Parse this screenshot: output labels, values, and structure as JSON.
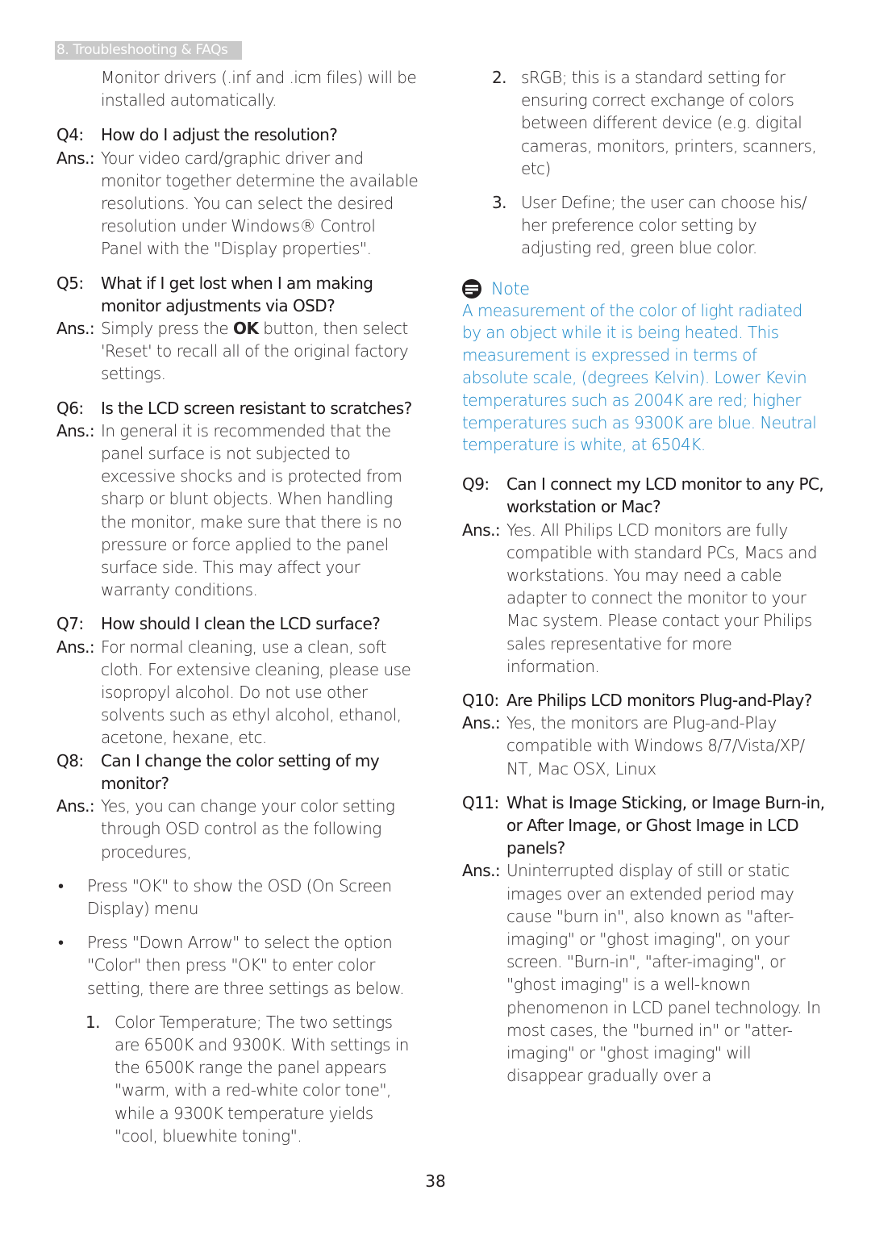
{
  "header": {
    "section_tag": "8. Troubleshooting & FAQs"
  },
  "left": {
    "intro_continuation": "Monitor drivers (.inf and .icm files) will be installed automatically.",
    "q4": {
      "label": "Q4:",
      "question": "How do I adjust the resolution?",
      "ans_label": "Ans.:",
      "answer": "Your video card/graphic driver and monitor together determine the available resolutions. You can select the desired resolution under Windows® Control Panel with the \"Display properties\"."
    },
    "q5": {
      "label": "Q5:",
      "question": "What if I get lost when I am making monitor adjustments via OSD?",
      "ans_label": "Ans.:",
      "answer_pre": "Simply press the ",
      "answer_bold": "OK",
      "answer_post": " button, then select 'Reset' to recall all of the original factory settings."
    },
    "q6": {
      "label": "Q6:",
      "question": "Is the LCD screen resistant to scratches?",
      "ans_label": "Ans.:",
      "answer": "In general it is recommended that the panel surface is not subjected to excessive shocks and is protected from sharp or blunt objects. When handling the monitor, make sure that there is no pressure or force applied to the panel surface side. This may affect your warranty conditions."
    },
    "q7": {
      "label": "Q7:",
      "question": "How should I clean the LCD surface?",
      "ans_label": "Ans.:",
      "answer": "For normal cleaning, use a clean, soft cloth. For extensive cleaning, please use isopropyl alcohol. Do not use other solvents such as ethyl alcohol, ethanol, acetone, hexane, etc."
    },
    "q8": {
      "label": "Q8:",
      "question": "Can I change the color setting of my monitor?",
      "ans_label": "Ans.:",
      "answer": "Yes, you can change your color setting through OSD control as the following procedures,"
    },
    "bullets": [
      {
        "marker": "•",
        "text": "Press \"OK\" to show the OSD (On Screen Display) menu"
      },
      {
        "marker": "•",
        "text": "Press \"Down Arrow\" to select the option \"Color\" then press \"OK\" to enter color setting, there are three settings as below."
      }
    ],
    "settings_first": {
      "number": "1.",
      "text": "Color Temperature; The two settings are 6500K and 9300K. With settings in the 6500K range the panel appears \"warm, with a red-white color tone\", while a 9300K temperature yields \"cool, bluewhite toning\"."
    }
  },
  "right": {
    "settings_rest": [
      {
        "number": "2.",
        "text": "sRGB; this is a standard setting for ensuring correct exchange of colors between different device (e.g. digital cameras, monitors, printers, scanners, etc)"
      },
      {
        "number": "3.",
        "text": "User Define; the user can choose his/ her preference color setting by adjusting red, green blue color."
      }
    ],
    "note": {
      "icon": "note-icon",
      "title": "Note",
      "body": "A measurement of the color of light radiated by an object while it is being heated. This measurement is expressed in terms of absolute scale, (degrees Kelvin). Lower Kevin temperatures such as 2004K are red; higher temperatures such as 9300K are blue. Neutral temperature is white, at 6504K.",
      "color": "#1a88c9"
    },
    "q9": {
      "label": "Q9:",
      "question": "Can I connect my LCD monitor to any PC, workstation or Mac?",
      "ans_label": "Ans.:",
      "answer": "Yes. All Philips LCD monitors are fully compatible with standard PCs, Macs and workstations. You may need a cable adapter to connect the monitor to your Mac system. Please contact your Philips sales representative for more information."
    },
    "q10": {
      "label": "Q10:",
      "question": "Are Philips LCD monitors Plug-and-Play?",
      "ans_label": "Ans.:",
      "answer": "Yes, the monitors are Plug-and-Play compatible with Windows 8/7/Vista/XP/ NT, Mac OSX, Linux"
    },
    "q11": {
      "label": "Q11:",
      "question": "What is Image Sticking, or Image Burn-in, or After Image, or Ghost Image in LCD panels?",
      "ans_label": "Ans.:",
      "answer": "Uninterrupted display of still or static images over an extended period may cause \"burn in\", also known as \"after-imaging\" or \"ghost imaging\", on your screen. \"Burn-in\", \"after-imaging\", or \"ghost imaging\" is a well-known phenomenon in LCD panel technology. In most cases, the \"burned in\" or \"atter-imaging\" or \"ghost imaging\" will disappear gradually over a"
    }
  },
  "footer": {
    "page_number": "38"
  }
}
